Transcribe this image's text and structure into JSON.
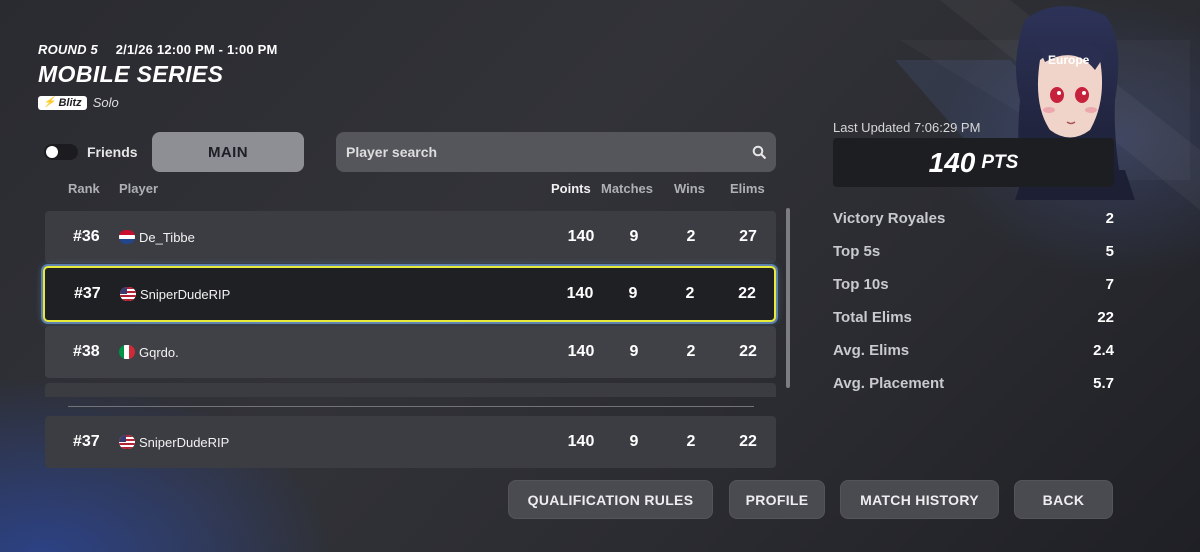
{
  "header": {
    "round": "ROUND 5",
    "datetime": "2/1/26 12:00 PM - 1:00 PM",
    "title": "MOBILE SERIES",
    "mode_badge": "Blitz",
    "mode": "Solo"
  },
  "filters": {
    "friends_label": "Friends",
    "friends_toggle_on": false,
    "main_tab": "MAIN",
    "search_placeholder": "Player search"
  },
  "columns": {
    "rank": "Rank",
    "player": "Player",
    "points": "Points",
    "matches": "Matches",
    "wins": "Wins",
    "elims": "Elims"
  },
  "rows": [
    {
      "rank": "#36",
      "flag": "netherlands",
      "player": "De_Tibbe",
      "points": "140",
      "matches": "9",
      "wins": "2",
      "elims": "27"
    },
    {
      "rank": "#37",
      "flag": "usa",
      "player": "SniperDudeRIP",
      "points": "140",
      "matches": "9",
      "wins": "2",
      "elims": "22",
      "highlighted": true
    },
    {
      "rank": "#38",
      "flag": "italy",
      "player": "Gqrdo.",
      "points": "140",
      "matches": "9",
      "wins": "2",
      "elims": "22"
    }
  ],
  "self_row": {
    "rank": "#37",
    "flag": "usa",
    "player": "SniperDudeRIP",
    "points": "140",
    "matches": "9",
    "wins": "2",
    "elims": "22"
  },
  "profile": {
    "region": "Europe",
    "last_updated": "Last Updated 7:06:29 PM",
    "points": "140",
    "points_unit": "PTS"
  },
  "stats": [
    {
      "label": "Victory Royales",
      "value": "2"
    },
    {
      "label": "Top 5s",
      "value": "5"
    },
    {
      "label": "Top 10s",
      "value": "7"
    },
    {
      "label": "Total Elims",
      "value": "22"
    },
    {
      "label": "Avg. Elims",
      "value": "2.4"
    },
    {
      "label": "Avg. Placement",
      "value": "5.7"
    }
  ],
  "buttons": {
    "qualification_rules": "QUALIFICATION RULES",
    "profile": "PROFILE",
    "match_history": "MATCH HISTORY",
    "back": "BACK"
  },
  "colors": {
    "highlight_border": "#e8ea3a",
    "background": "#2f3036"
  }
}
